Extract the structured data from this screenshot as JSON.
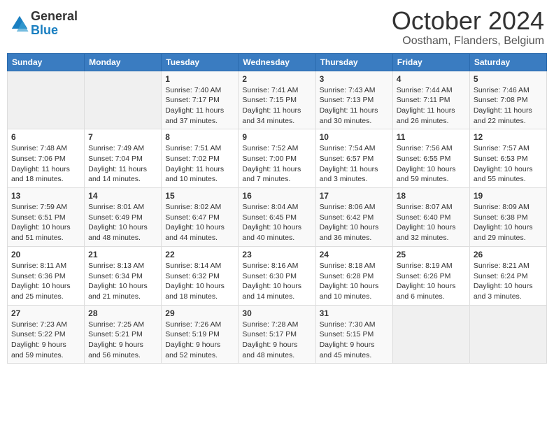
{
  "logo": {
    "line1": "General",
    "line2": "Blue"
  },
  "title": "October 2024",
  "location": "Oostham, Flanders, Belgium",
  "headers": [
    "Sunday",
    "Monday",
    "Tuesday",
    "Wednesday",
    "Thursday",
    "Friday",
    "Saturday"
  ],
  "weeks": [
    [
      {
        "day": "",
        "info": ""
      },
      {
        "day": "",
        "info": ""
      },
      {
        "day": "1",
        "info": "Sunrise: 7:40 AM\nSunset: 7:17 PM\nDaylight: 11 hours and 37 minutes."
      },
      {
        "day": "2",
        "info": "Sunrise: 7:41 AM\nSunset: 7:15 PM\nDaylight: 11 hours and 34 minutes."
      },
      {
        "day": "3",
        "info": "Sunrise: 7:43 AM\nSunset: 7:13 PM\nDaylight: 11 hours and 30 minutes."
      },
      {
        "day": "4",
        "info": "Sunrise: 7:44 AM\nSunset: 7:11 PM\nDaylight: 11 hours and 26 minutes."
      },
      {
        "day": "5",
        "info": "Sunrise: 7:46 AM\nSunset: 7:08 PM\nDaylight: 11 hours and 22 minutes."
      }
    ],
    [
      {
        "day": "6",
        "info": "Sunrise: 7:48 AM\nSunset: 7:06 PM\nDaylight: 11 hours and 18 minutes."
      },
      {
        "day": "7",
        "info": "Sunrise: 7:49 AM\nSunset: 7:04 PM\nDaylight: 11 hours and 14 minutes."
      },
      {
        "day": "8",
        "info": "Sunrise: 7:51 AM\nSunset: 7:02 PM\nDaylight: 11 hours and 10 minutes."
      },
      {
        "day": "9",
        "info": "Sunrise: 7:52 AM\nSunset: 7:00 PM\nDaylight: 11 hours and 7 minutes."
      },
      {
        "day": "10",
        "info": "Sunrise: 7:54 AM\nSunset: 6:57 PM\nDaylight: 11 hours and 3 minutes."
      },
      {
        "day": "11",
        "info": "Sunrise: 7:56 AM\nSunset: 6:55 PM\nDaylight: 10 hours and 59 minutes."
      },
      {
        "day": "12",
        "info": "Sunrise: 7:57 AM\nSunset: 6:53 PM\nDaylight: 10 hours and 55 minutes."
      }
    ],
    [
      {
        "day": "13",
        "info": "Sunrise: 7:59 AM\nSunset: 6:51 PM\nDaylight: 10 hours and 51 minutes."
      },
      {
        "day": "14",
        "info": "Sunrise: 8:01 AM\nSunset: 6:49 PM\nDaylight: 10 hours and 48 minutes."
      },
      {
        "day": "15",
        "info": "Sunrise: 8:02 AM\nSunset: 6:47 PM\nDaylight: 10 hours and 44 minutes."
      },
      {
        "day": "16",
        "info": "Sunrise: 8:04 AM\nSunset: 6:45 PM\nDaylight: 10 hours and 40 minutes."
      },
      {
        "day": "17",
        "info": "Sunrise: 8:06 AM\nSunset: 6:42 PM\nDaylight: 10 hours and 36 minutes."
      },
      {
        "day": "18",
        "info": "Sunrise: 8:07 AM\nSunset: 6:40 PM\nDaylight: 10 hours and 32 minutes."
      },
      {
        "day": "19",
        "info": "Sunrise: 8:09 AM\nSunset: 6:38 PM\nDaylight: 10 hours and 29 minutes."
      }
    ],
    [
      {
        "day": "20",
        "info": "Sunrise: 8:11 AM\nSunset: 6:36 PM\nDaylight: 10 hours and 25 minutes."
      },
      {
        "day": "21",
        "info": "Sunrise: 8:13 AM\nSunset: 6:34 PM\nDaylight: 10 hours and 21 minutes."
      },
      {
        "day": "22",
        "info": "Sunrise: 8:14 AM\nSunset: 6:32 PM\nDaylight: 10 hours and 18 minutes."
      },
      {
        "day": "23",
        "info": "Sunrise: 8:16 AM\nSunset: 6:30 PM\nDaylight: 10 hours and 14 minutes."
      },
      {
        "day": "24",
        "info": "Sunrise: 8:18 AM\nSunset: 6:28 PM\nDaylight: 10 hours and 10 minutes."
      },
      {
        "day": "25",
        "info": "Sunrise: 8:19 AM\nSunset: 6:26 PM\nDaylight: 10 hours and 6 minutes."
      },
      {
        "day": "26",
        "info": "Sunrise: 8:21 AM\nSunset: 6:24 PM\nDaylight: 10 hours and 3 minutes."
      }
    ],
    [
      {
        "day": "27",
        "info": "Sunrise: 7:23 AM\nSunset: 5:22 PM\nDaylight: 9 hours and 59 minutes."
      },
      {
        "day": "28",
        "info": "Sunrise: 7:25 AM\nSunset: 5:21 PM\nDaylight: 9 hours and 56 minutes."
      },
      {
        "day": "29",
        "info": "Sunrise: 7:26 AM\nSunset: 5:19 PM\nDaylight: 9 hours and 52 minutes."
      },
      {
        "day": "30",
        "info": "Sunrise: 7:28 AM\nSunset: 5:17 PM\nDaylight: 9 hours and 48 minutes."
      },
      {
        "day": "31",
        "info": "Sunrise: 7:30 AM\nSunset: 5:15 PM\nDaylight: 9 hours and 45 minutes."
      },
      {
        "day": "",
        "info": ""
      },
      {
        "day": "",
        "info": ""
      }
    ]
  ]
}
